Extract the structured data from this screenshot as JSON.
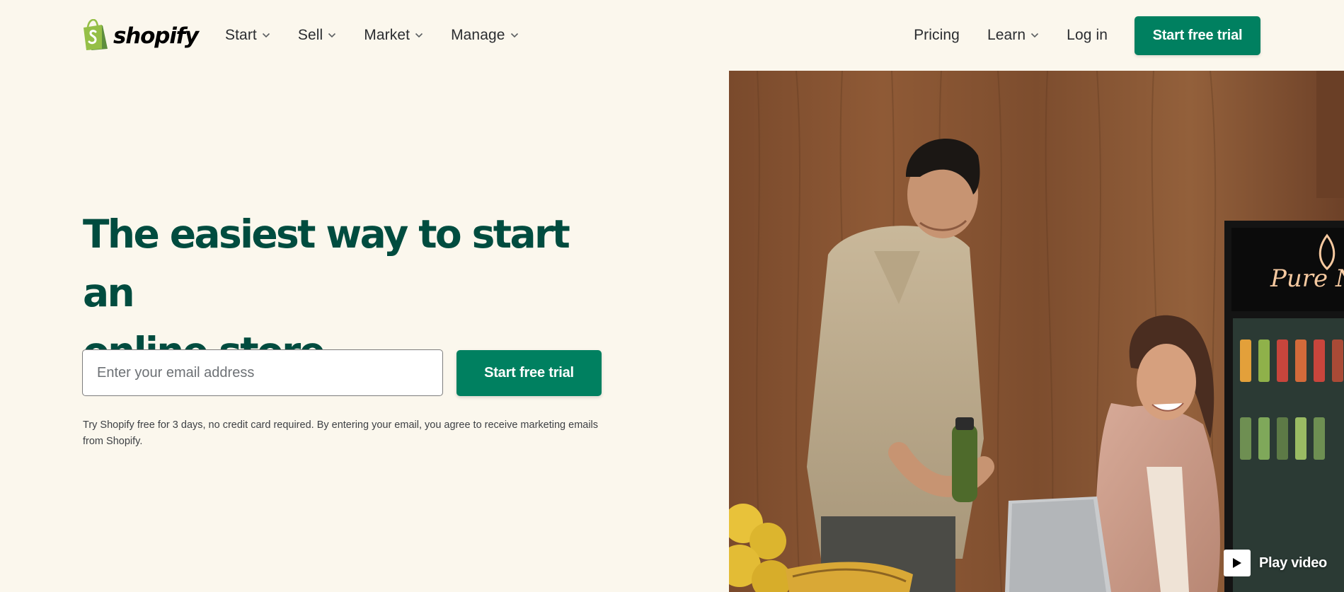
{
  "header": {
    "logo_text": "shopify",
    "nav_left": [
      {
        "label": "Start"
      },
      {
        "label": "Sell"
      },
      {
        "label": "Market"
      },
      {
        "label": "Manage"
      }
    ],
    "nav_right": {
      "pricing": "Pricing",
      "learn": "Learn",
      "login": "Log in",
      "cta": "Start free trial"
    }
  },
  "hero": {
    "title_line1": "The easiest way to start an",
    "title_line2": "online store",
    "email_placeholder": "Enter your email address",
    "email_value": "",
    "cta": "Start free trial",
    "disclaimer": "Try Shopify free for 3 days, no credit card required. By entering your email, you agree to receive marketing emails from Shopify.",
    "image_sign_text": "Pure Ne",
    "play_video_label": "Play video"
  },
  "colors": {
    "page_background": "#fbf7ed",
    "brand_green": "#008060",
    "heading_green": "#004c3f",
    "logo_green": "#95bf47",
    "text_dark": "#212326"
  },
  "icons": {
    "logo": "shopify-bag-icon",
    "dropdown": "chevron-down-icon",
    "play": "play-icon"
  }
}
